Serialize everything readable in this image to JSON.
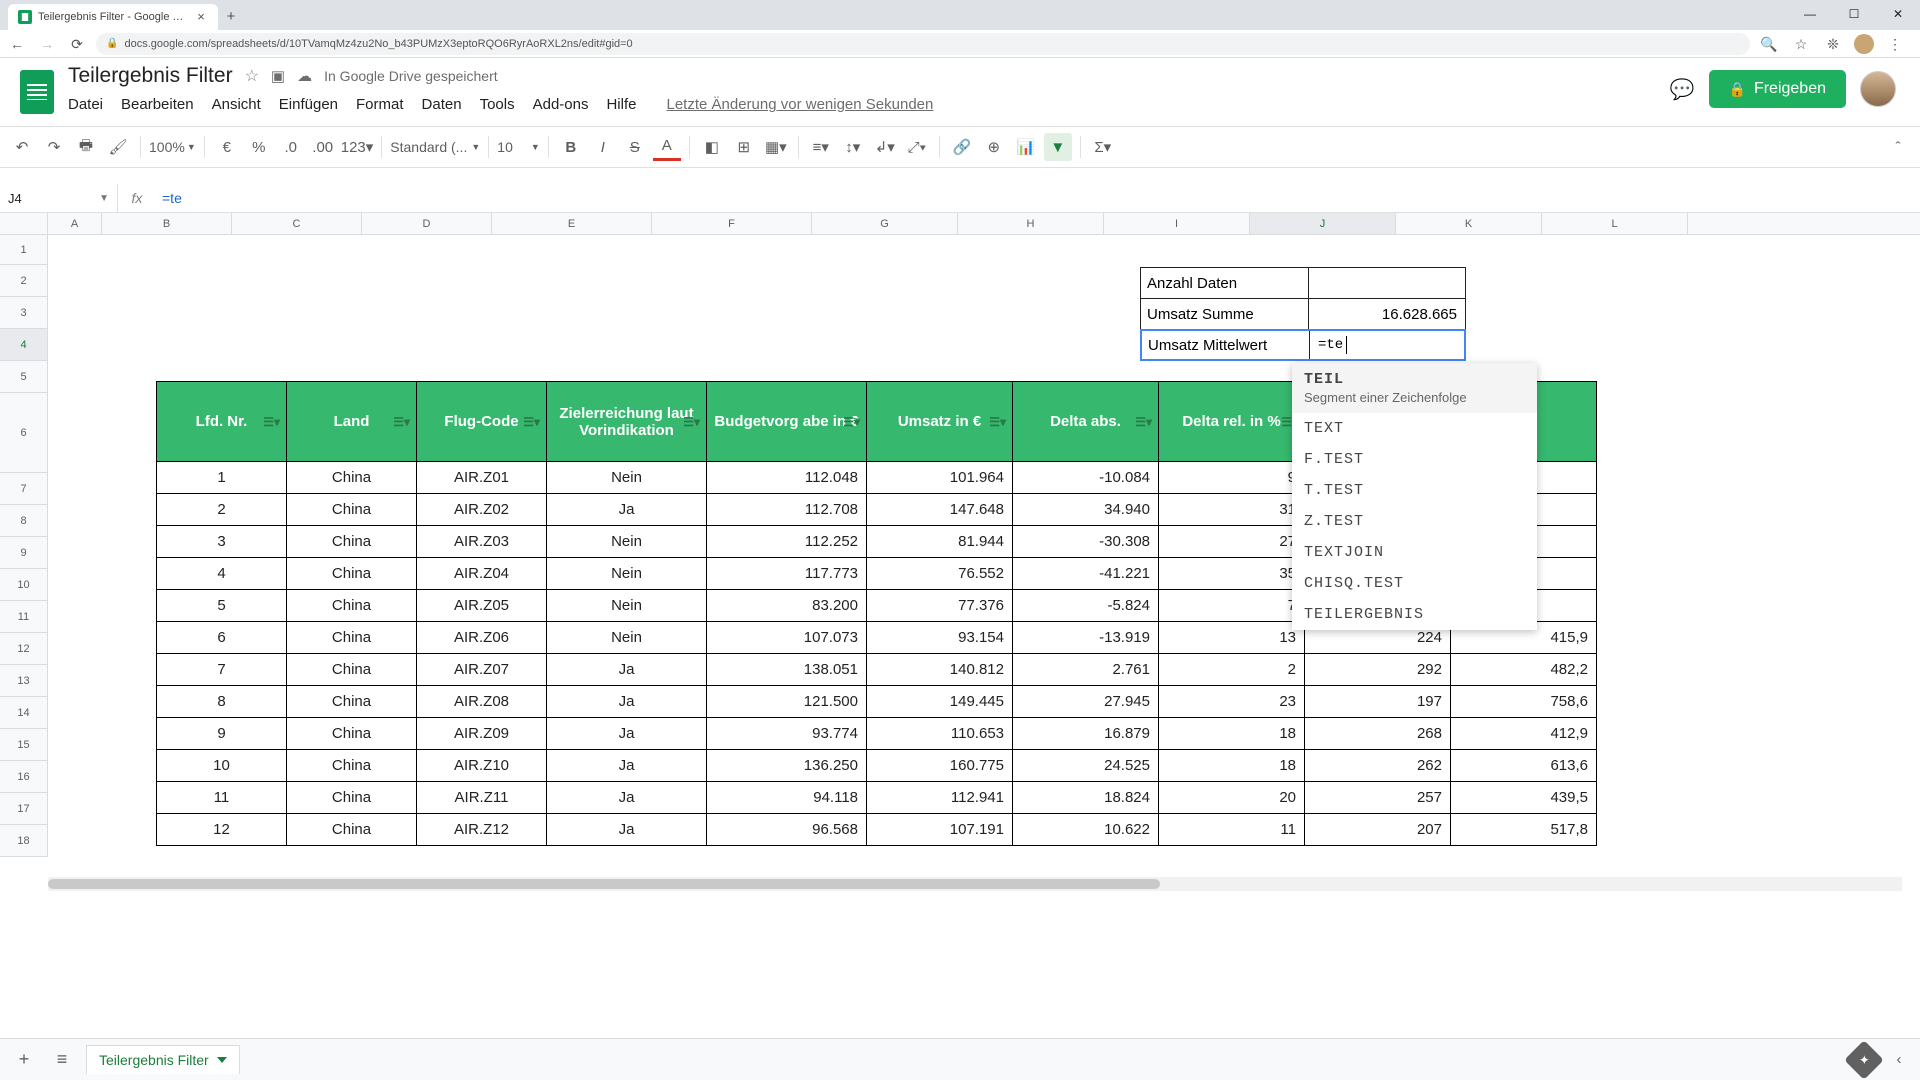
{
  "browser": {
    "tab_title": "Teilergebnis Filter - Google Tabe",
    "url": "docs.google.com/spreadsheets/d/10TVamqMz4zu2No_b43PUMzX3eptoRQO6RyrAoRXL2ns/edit#gid=0"
  },
  "doc": {
    "title": "Teilergebnis Filter",
    "cloud_status": "In Google Drive gespeichert",
    "menus": [
      "Datei",
      "Bearbeiten",
      "Ansicht",
      "Einfügen",
      "Format",
      "Daten",
      "Tools",
      "Add-ons",
      "Hilfe"
    ],
    "last_edit": "Letzte Änderung vor wenigen Sekunden",
    "share_label": "Freigeben"
  },
  "toolbar": {
    "zoom": "100%",
    "font": "Standard (...",
    "font_size": "10"
  },
  "name_box": "J4",
  "formula_bar": "=te",
  "summary": [
    {
      "label": "Anzahl Daten",
      "value": ""
    },
    {
      "label": "Umsatz Summe",
      "value": "16.628.665"
    },
    {
      "label": "Umsatz Mittelwert",
      "value": "=te"
    }
  ],
  "autocomplete": {
    "first": "TEIL",
    "first_desc": "Segment einer Zeichenfolge",
    "items": [
      "TEXT",
      "F.TEST",
      "T.TEST",
      "Z.TEST",
      "TEXTJOIN",
      "CHISQ.TEST",
      "TEILERGEBNIS"
    ]
  },
  "columns": [
    "A",
    "B",
    "C",
    "D",
    "E",
    "F",
    "G",
    "H",
    "I",
    "J",
    "K",
    "L"
  ],
  "row_numbers": [
    1,
    2,
    3,
    4,
    5,
    6,
    7,
    8,
    9,
    10,
    11,
    12,
    13,
    14,
    15,
    16,
    17,
    18
  ],
  "table": {
    "headers": [
      "Lfd. Nr.",
      "Land",
      "Flug-Code",
      "Zielerreichung laut Vorindikation",
      "Budgetvorg abe in €",
      "Umsatz in €",
      "Delta abs.",
      "Delta rel. in %",
      "",
      ""
    ],
    "header_cols": [
      "B",
      "C",
      "D",
      "E",
      "F",
      "G",
      "H",
      "I",
      "J",
      "K"
    ],
    "rows": [
      {
        "n": "1",
        "land": "China",
        "code": "AIR.Z01",
        "ziel": "Nein",
        "budget": "112.048",
        "umsatz": "101.964",
        "dabs": "-10.084",
        "drel": "9",
        "j": "",
        "k": ""
      },
      {
        "n": "2",
        "land": "China",
        "code": "AIR.Z02",
        "ziel": "Ja",
        "budget": "112.708",
        "umsatz": "147.648",
        "dabs": "34.940",
        "drel": "31",
        "j": "",
        "k": ""
      },
      {
        "n": "3",
        "land": "China",
        "code": "AIR.Z03",
        "ziel": "Nein",
        "budget": "112.252",
        "umsatz": "81.944",
        "dabs": "-30.308",
        "drel": "27",
        "j": "",
        "k": ""
      },
      {
        "n": "4",
        "land": "China",
        "code": "AIR.Z04",
        "ziel": "Nein",
        "budget": "117.773",
        "umsatz": "76.552",
        "dabs": "-41.221",
        "drel": "35",
        "j": "",
        "k": ""
      },
      {
        "n": "5",
        "land": "China",
        "code": "AIR.Z05",
        "ziel": "Nein",
        "budget": "83.200",
        "umsatz": "77.376",
        "dabs": "-5.824",
        "drel": "7",
        "j": "",
        "k": ""
      },
      {
        "n": "6",
        "land": "China",
        "code": "AIR.Z06",
        "ziel": "Nein",
        "budget": "107.073",
        "umsatz": "93.154",
        "dabs": "-13.919",
        "drel": "13",
        "j": "224",
        "k": "415,9"
      },
      {
        "n": "7",
        "land": "China",
        "code": "AIR.Z07",
        "ziel": "Ja",
        "budget": "138.051",
        "umsatz": "140.812",
        "dabs": "2.761",
        "drel": "2",
        "j": "292",
        "k": "482,2"
      },
      {
        "n": "8",
        "land": "China",
        "code": "AIR.Z08",
        "ziel": "Ja",
        "budget": "121.500",
        "umsatz": "149.445",
        "dabs": "27.945",
        "drel": "23",
        "j": "197",
        "k": "758,6"
      },
      {
        "n": "9",
        "land": "China",
        "code": "AIR.Z09",
        "ziel": "Ja",
        "budget": "93.774",
        "umsatz": "110.653",
        "dabs": "16.879",
        "drel": "18",
        "j": "268",
        "k": "412,9"
      },
      {
        "n": "10",
        "land": "China",
        "code": "AIR.Z10",
        "ziel": "Ja",
        "budget": "136.250",
        "umsatz": "160.775",
        "dabs": "24.525",
        "drel": "18",
        "j": "262",
        "k": "613,6"
      },
      {
        "n": "11",
        "land": "China",
        "code": "AIR.Z11",
        "ziel": "Ja",
        "budget": "94.118",
        "umsatz": "112.941",
        "dabs": "18.824",
        "drel": "20",
        "j": "257",
        "k": "439,5"
      },
      {
        "n": "12",
        "land": "China",
        "code": "AIR.Z12",
        "ziel": "Ja",
        "budget": "96.568",
        "umsatz": "107.191",
        "dabs": "10.622",
        "drel": "11",
        "j": "207",
        "k": "517,8"
      }
    ]
  },
  "sheet_tab": "Teilergebnis Filter"
}
